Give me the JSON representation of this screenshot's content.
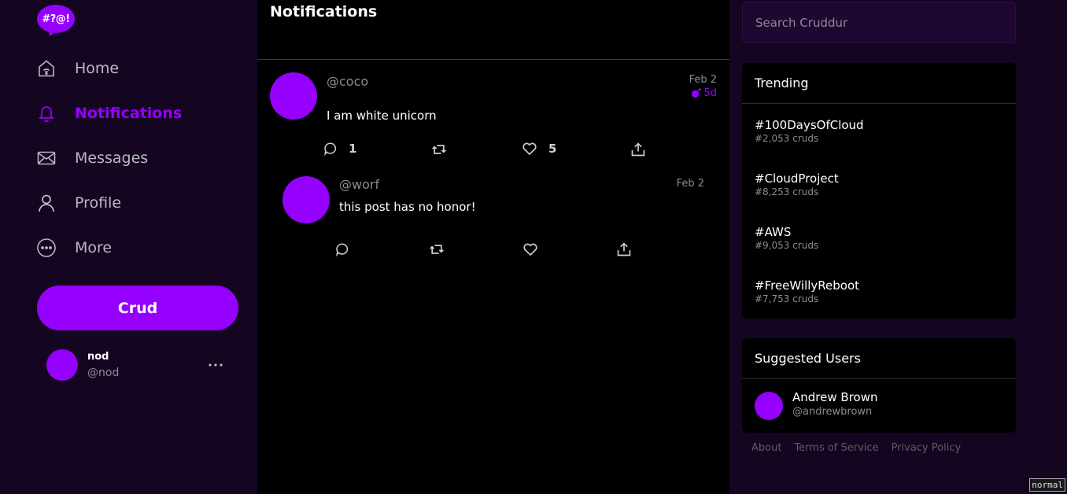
{
  "logo": {
    "text": "#?@!"
  },
  "nav": [
    {
      "label": "Home",
      "icon": "home-icon"
    },
    {
      "label": "Notifications",
      "icon": "bell-icon"
    },
    {
      "label": "Messages",
      "icon": "mail-icon"
    },
    {
      "label": "Profile",
      "icon": "person-icon"
    },
    {
      "label": "More",
      "icon": "more-circle-icon"
    }
  ],
  "active_nav": "Notifications",
  "crud_button": {
    "label": "Crud"
  },
  "current_user": {
    "name": "nod",
    "handle": "@nod"
  },
  "main": {
    "title": "Notifications",
    "activities": [
      {
        "handle": "@coco",
        "message": "I am white unicorn",
        "date": "Feb 2",
        "expires": "5d",
        "reply_count": "1",
        "like_count": "5"
      },
      {
        "handle": "@worf",
        "message": "this post has no honor!",
        "date": "Feb 2"
      }
    ]
  },
  "search": {
    "placeholder": "Search Cruddur"
  },
  "trending": {
    "title": "Trending",
    "items": [
      {
        "tag": "#100DaysOfCloud",
        "count": "#2,053 cruds"
      },
      {
        "tag": "#CloudProject",
        "count": "#8,253 cruds"
      },
      {
        "tag": "#AWS",
        "count": "#9,053 cruds"
      },
      {
        "tag": "#FreeWillyReboot",
        "count": "#7,753 cruds"
      }
    ]
  },
  "suggested": {
    "title": "Suggested Users",
    "users": [
      {
        "name": "Andrew Brown",
        "handle": "@andrewbrown"
      }
    ]
  },
  "footer": {
    "links": [
      "About",
      "Terms of Service",
      "Privacy Policy"
    ]
  },
  "mode_badge": "normal",
  "colors": {
    "accent": "#9500ff",
    "background": "#140520",
    "feed": "#000000",
    "muted": "#8b8b99"
  }
}
